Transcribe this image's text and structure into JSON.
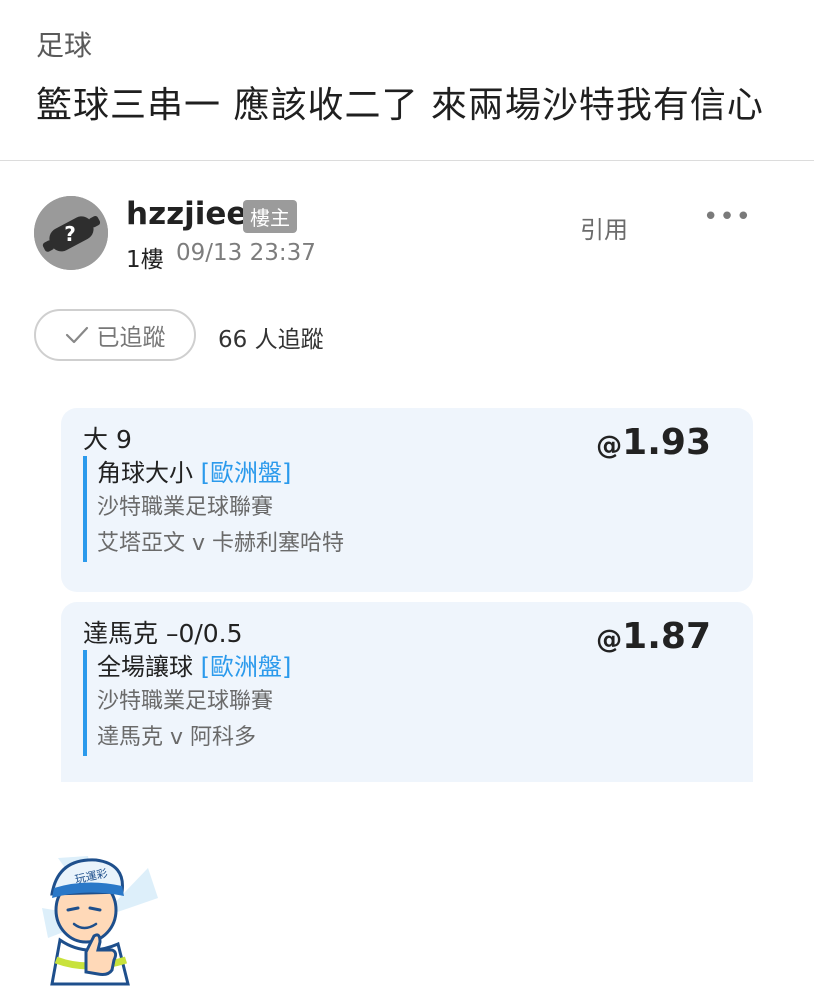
{
  "forum": {
    "category": "足球"
  },
  "post": {
    "title": "籃球三串一 應該收二了 來兩場沙特我有信心",
    "author": "hzzjiee",
    "op_badge": "樓主",
    "floor": "1樓",
    "time": "09/13 23:37",
    "quote_label": "引用",
    "more_label": "•••"
  },
  "follow": {
    "label": "已追蹤",
    "followers": "66 人追蹤"
  },
  "bets": [
    {
      "pick": "大 9",
      "odds_prefix": "@",
      "odds": "1.93",
      "market": "角球大小",
      "market_tag": "[歐洲盤]",
      "league": "沙特職業足球聯賽",
      "match": "艾塔亞文 v 卡赫利塞哈特"
    },
    {
      "pick": "達馬克 –0/0.5",
      "odds_prefix": "@",
      "odds": "1.87",
      "market": "全場讓球",
      "market_tag": "[歐洲盤]",
      "league": "沙特職業足球聯賽",
      "match": "達馬克 v 阿科多"
    }
  ],
  "sticker": {
    "text": "讚",
    "cap_text": "玩運彩"
  },
  "colors": {
    "accent": "#2b9aec",
    "card_bg": "#eff5fc",
    "badge_bg": "#9b9b9b"
  }
}
